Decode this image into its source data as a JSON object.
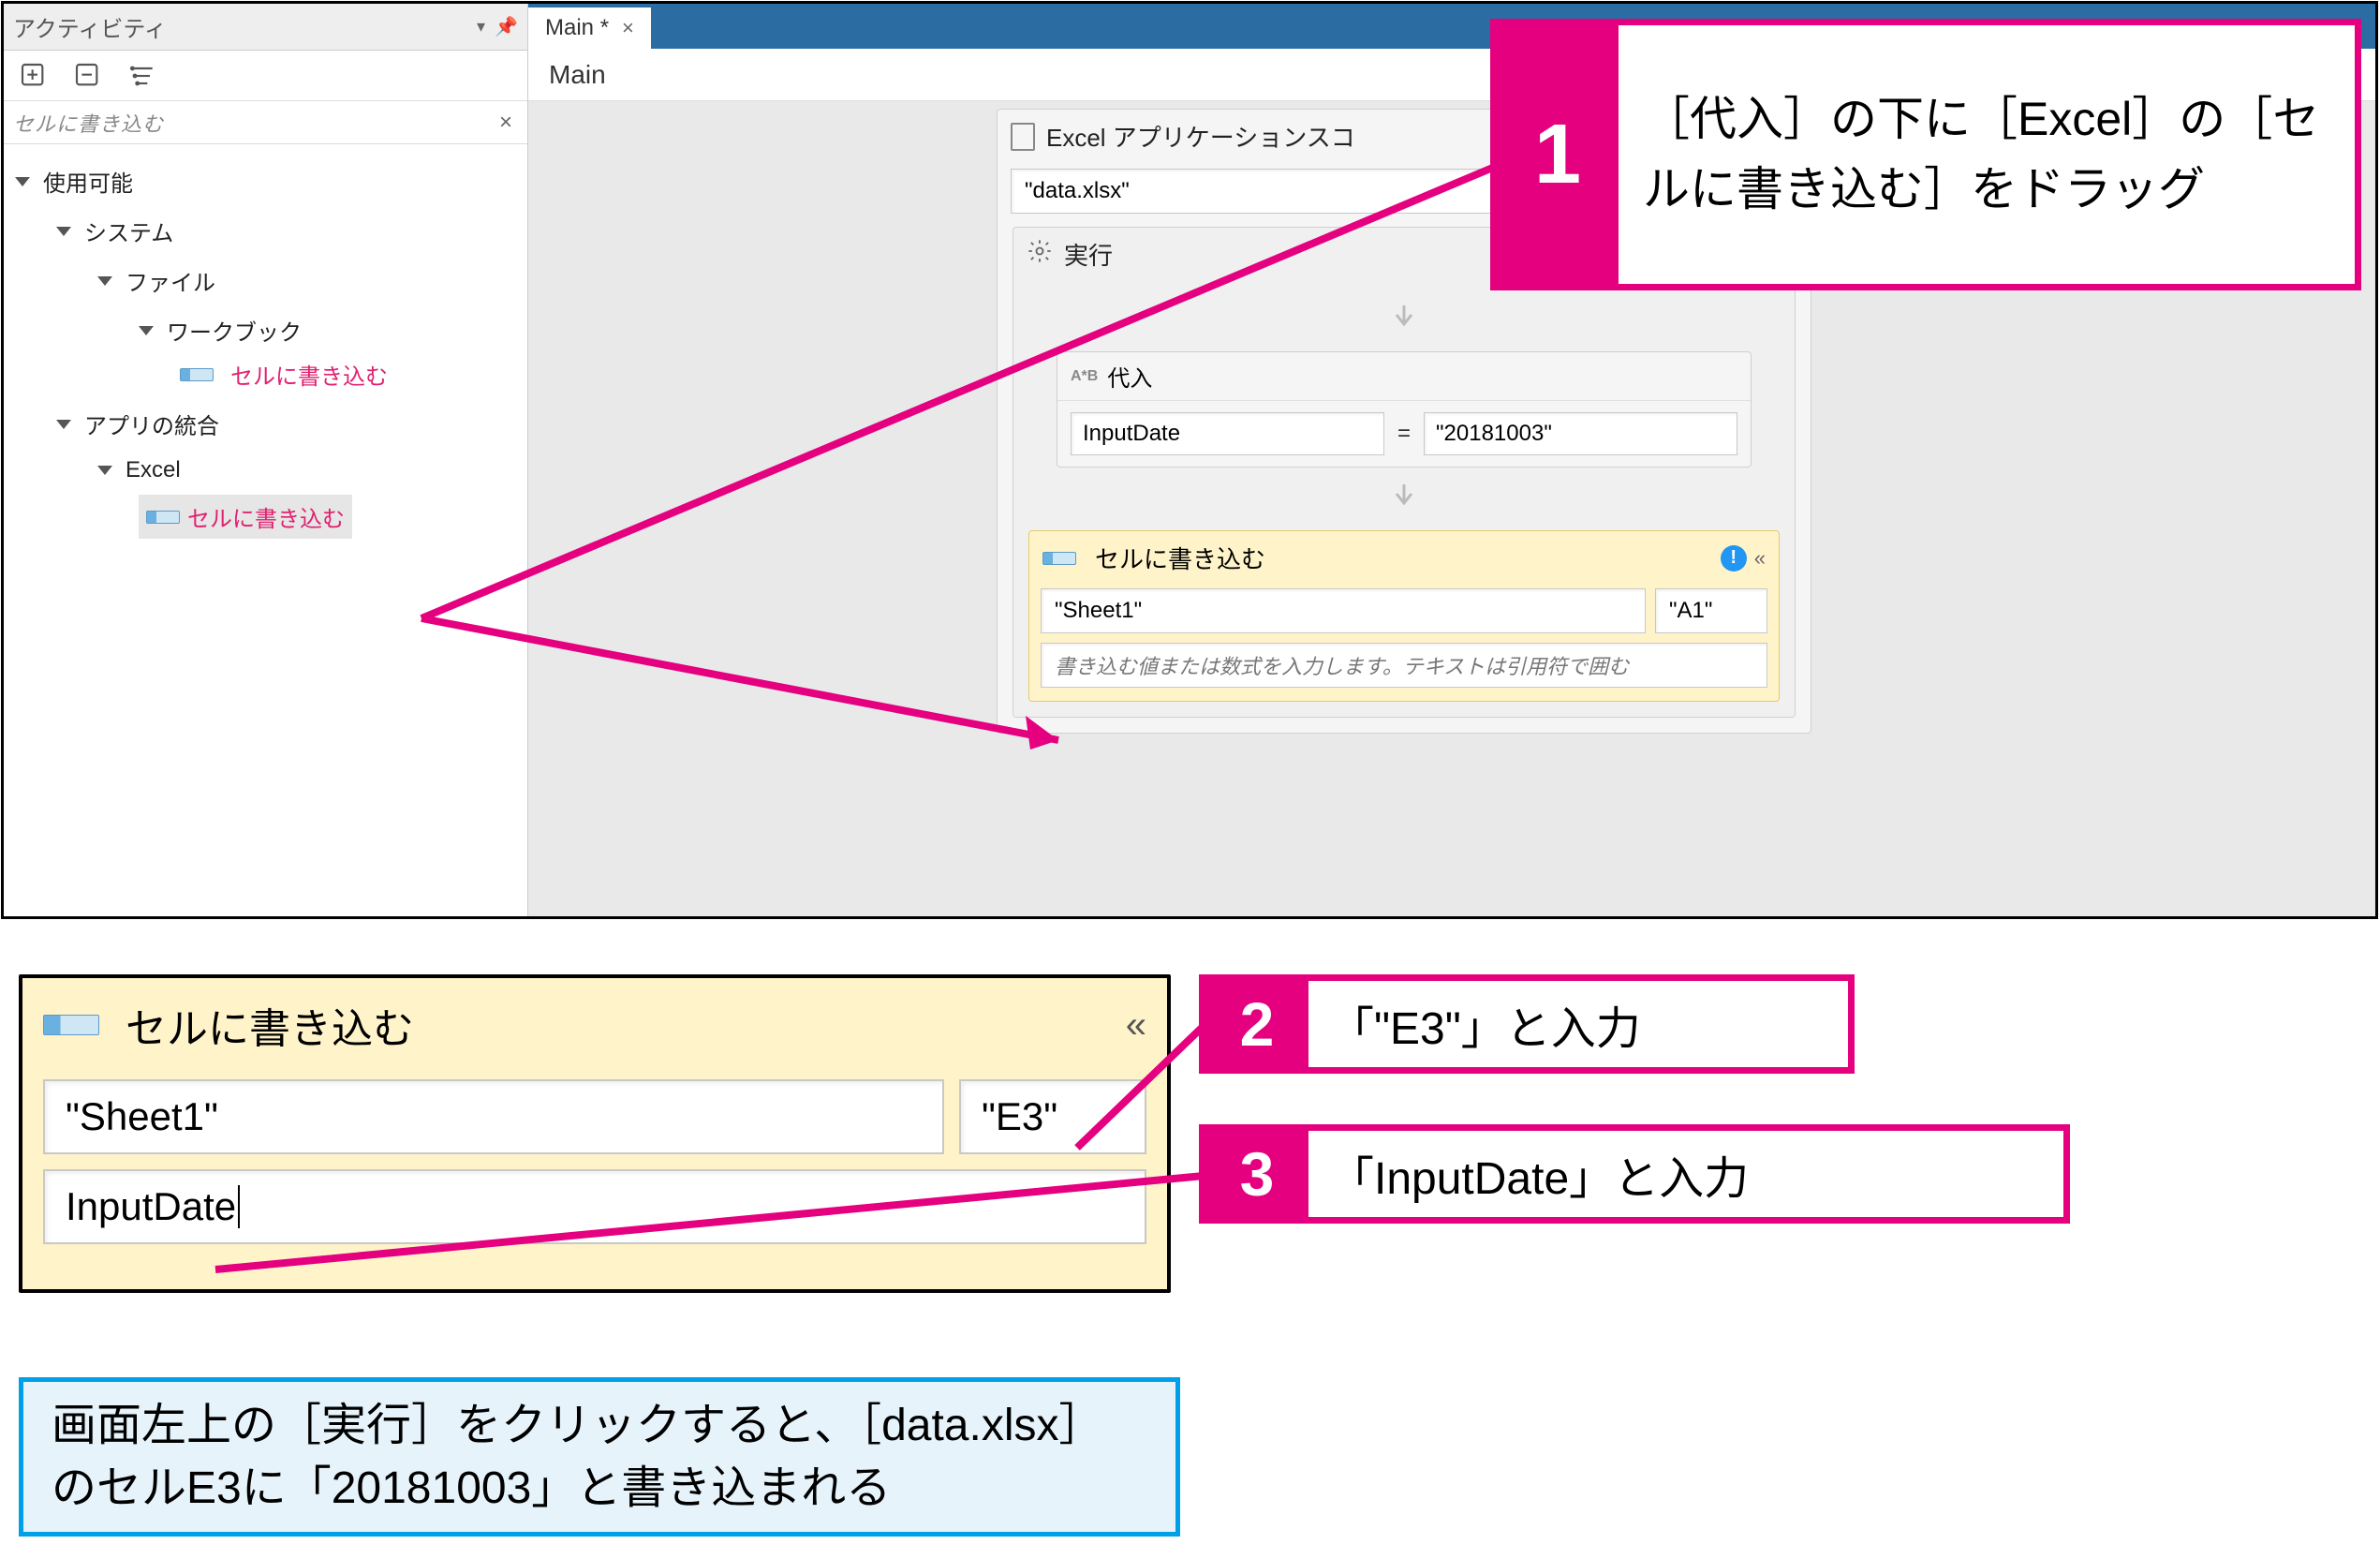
{
  "left_panel": {
    "title": "アクティビティ",
    "search_placeholder": "セルに書き込む",
    "tree": {
      "root": "使用可能",
      "system": "システム",
      "file": "ファイル",
      "workbook": "ワークブック",
      "write_cell_1": "セルに書き込む",
      "app_integration": "アプリの統合",
      "excel": "Excel",
      "write_cell_2": "セルに書き込む"
    }
  },
  "tab": {
    "name": "Main *",
    "breadcrumb": "Main"
  },
  "scope": {
    "title": "Excel アプリケーションスコ",
    "path": "\"data.xlsx\"",
    "do_title": "実行",
    "assign": {
      "title": "代入",
      "ab_label": "A*B",
      "left": "InputDate",
      "eq": "=",
      "right": "\"20181003\""
    },
    "write": {
      "title": "セルに書き込む",
      "sheet": "\"Sheet1\"",
      "cell": "\"A1\"",
      "value_placeholder": "書き込む値または数式を入力します。テキストは引用符で囲む"
    }
  },
  "detail": {
    "title": "セルに書き込む",
    "sheet": "\"Sheet1\"",
    "cell": "\"E3\"",
    "value": "InputDate"
  },
  "callouts": {
    "c1_num": "1",
    "c1_text": "［代入］の下に［Excel］の［セルに書き込む］をドラッグ",
    "c2_num": "2",
    "c2_text": "「\"E3\"」と入力",
    "c3_num": "3",
    "c3_text": "「InputDate」と入力"
  },
  "blue_note": "画面左上の［実行］をクリックすると、［data.xlsx］のセルE3に「20181003」と書き込まれる"
}
